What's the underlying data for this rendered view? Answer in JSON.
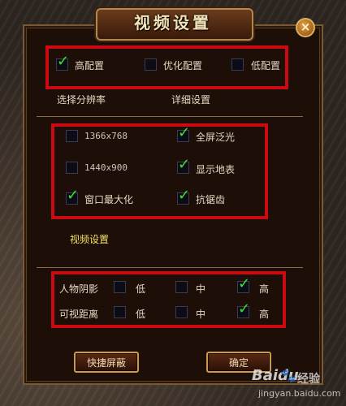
{
  "window": {
    "title": "视频设置"
  },
  "presets": {
    "high": {
      "label": "高配置",
      "checked": true
    },
    "optimized": {
      "label": "优化配置",
      "checked": false
    },
    "low": {
      "label": "低配置",
      "checked": false
    }
  },
  "links": {
    "resolution": "选择分辨率",
    "detail": "详细设置"
  },
  "display": {
    "res1366": {
      "label": "1366x768",
      "checked": false
    },
    "res1440": {
      "label": "1440x900",
      "checked": false
    },
    "maximize": {
      "label": "窗口最大化",
      "checked": true
    },
    "fullscreen_bloom": {
      "label": "全屏泛光",
      "checked": true
    },
    "show_ground": {
      "label": "显示地表",
      "checked": true
    },
    "antialias": {
      "label": "抗锯齿",
      "checked": true
    }
  },
  "video_settings_label": "视频设置",
  "quality": {
    "shadow": {
      "label": "人物阴影",
      "low": "低",
      "mid": "中",
      "high": "高",
      "selected": "high"
    },
    "view_distance": {
      "label": "可视距离",
      "low": "低",
      "mid": "中",
      "high": "高",
      "selected": "high"
    }
  },
  "buttons": {
    "shield": "快捷屏蔽",
    "confirm": "确定"
  },
  "watermark": {
    "brand": "Baidu",
    "brand_cn": "经验",
    "url": "jingyan.baidu.com"
  },
  "colors": {
    "highlight_box": "#cc0a12",
    "check": "#3fe03a",
    "accent_text": "#f0e060"
  }
}
